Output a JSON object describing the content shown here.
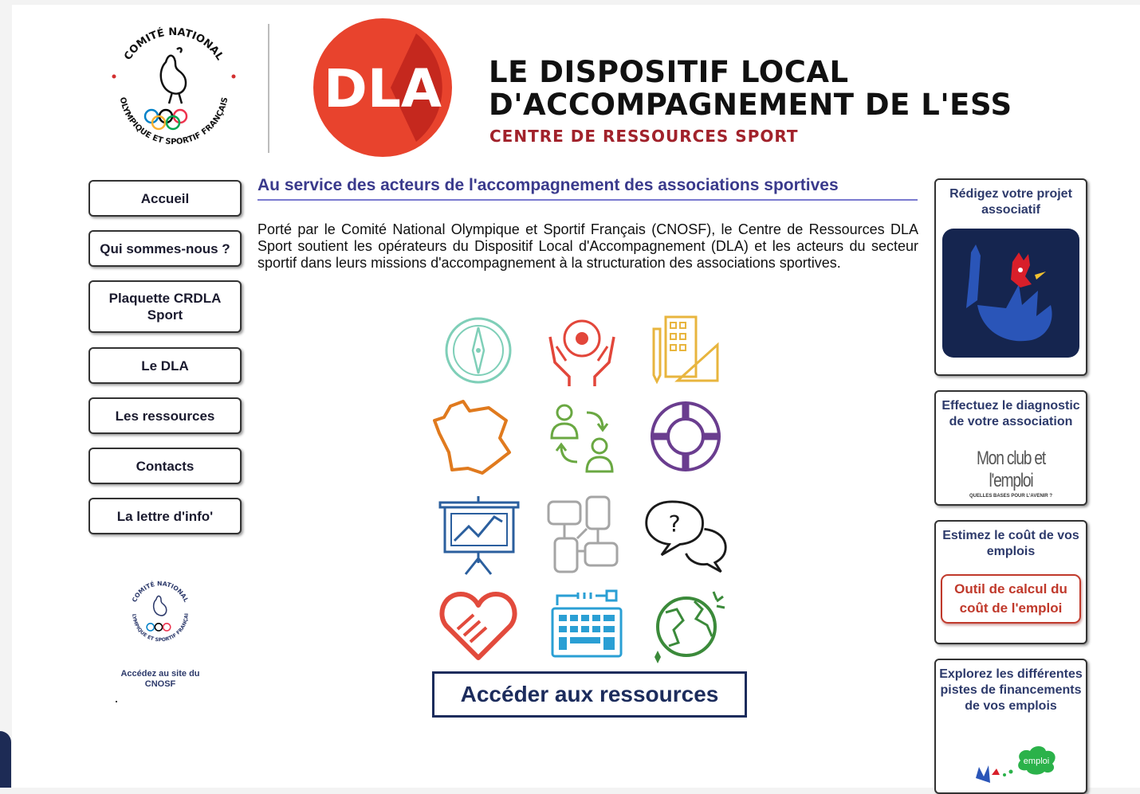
{
  "header": {
    "cnosf_logo_text": "COMITÉ NATIONAL OLYMPIQUE ET SPORTIF FRANÇAIS",
    "dla_logo_text": "DLA",
    "title_line1": "LE DISPOSITIF LOCAL",
    "title_line2": "D'ACCOMPAGNEMENT DE L'ESS",
    "subtitle": "CENTRE DE RESSOURCES SPORT"
  },
  "nav": {
    "items": [
      {
        "label": "Accueil"
      },
      {
        "label": "Qui sommes-nous ?"
      },
      {
        "label": "Plaquette CRDLA Sport"
      },
      {
        "label": "Le DLA"
      },
      {
        "label": "Les ressources"
      },
      {
        "label": "Contacts"
      },
      {
        "label": "La lettre d'info'"
      }
    ],
    "cnosf_link": "Accédez au site du CNOSF"
  },
  "main": {
    "heading": "Au service des acteurs de l'accompagnement des associations sportives",
    "intro": "Porté par le Comité National Olympique et Sportif Français (CNOSF), le Centre de Ressources DLA Sport soutient les opérateurs du Dispositif Local d'Accompagnement (DLA) et les acteurs du secteur sportif dans leurs missions d'accompagnement à la structuration des associations sportives.",
    "cta": "Accéder aux ressources",
    "icons": [
      {
        "name": "compass-icon",
        "color": "#7fcfb8"
      },
      {
        "name": "hands-ball-icon",
        "color": "#e2463a"
      },
      {
        "name": "building-tools-icon",
        "color": "#e8b53e"
      },
      {
        "name": "france-map-icon",
        "color": "#e07a1e"
      },
      {
        "name": "people-exchange-icon",
        "color": "#6aa842"
      },
      {
        "name": "lifebuoy-icon",
        "color": "#6a3d8f"
      },
      {
        "name": "presentation-chart-icon",
        "color": "#2b5f9e"
      },
      {
        "name": "teamwork-hands-icon",
        "color": "#a5a5a5"
      },
      {
        "name": "speech-bubbles-icon",
        "color": "#1a1a1a"
      },
      {
        "name": "heart-handshake-icon",
        "color": "#e24a3c"
      },
      {
        "name": "keyboard-cable-icon",
        "color": "#2a9fd4"
      },
      {
        "name": "globe-icon",
        "color": "#3b8a3a"
      }
    ]
  },
  "sidebar": {
    "card1_title": "Rédigez votre projet associatif",
    "card2_title": "Effectuez le diagnostic de votre association",
    "card2_logo_title": "Mon club et l'emploi",
    "card2_logo_sub": "QUELLES BASES POUR L'AVENIR ?",
    "card3_title": "Estimez le coût de vos emplois",
    "card3_button": "Outil de calcul du coût de l'emploi",
    "card4_title": "Explorez les différentes pistes de financements de vos emplois",
    "card4_badge": "emploi"
  },
  "colors": {
    "dla_red": "#e8432d",
    "subtitle_red": "#a1222b",
    "heading_blue": "#3a3a8c",
    "cta_navy": "#1c2c5c"
  }
}
